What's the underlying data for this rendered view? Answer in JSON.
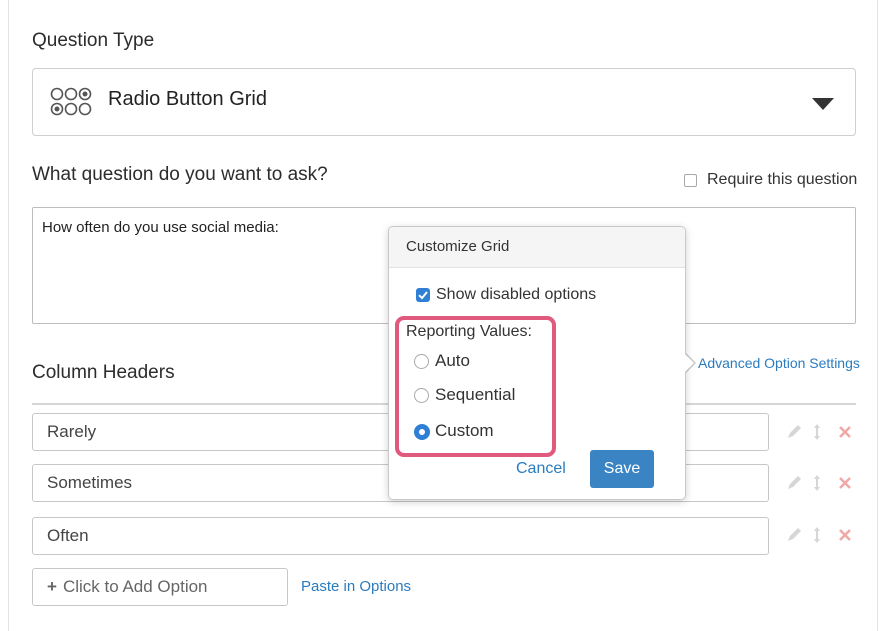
{
  "question_type": {
    "label": "Question Type",
    "selected": "Radio Button Grid"
  },
  "question": {
    "label": "What question do you want to ask?",
    "require_label": "Require this question",
    "require_checked": false,
    "text": "How often do you use social media:"
  },
  "columns": {
    "label": "Column Headers",
    "advanced_link": "Advanced Option Settings",
    "options": [
      "Rarely",
      "Sometimes",
      "Often"
    ],
    "add_placeholder": "Click to Add Option",
    "paste_link": "Paste in Options"
  },
  "popover": {
    "title": "Customize Grid",
    "show_disabled_label": "Show disabled options",
    "show_disabled_checked": true,
    "reporting_label": "Reporting Values:",
    "radios": [
      {
        "label": "Auto",
        "checked": false
      },
      {
        "label": "Sequential",
        "checked": false
      },
      {
        "label": "Custom",
        "checked": true
      }
    ],
    "cancel_label": "Cancel",
    "save_label": "Save"
  },
  "colors": {
    "accent": "#2f7fd6",
    "link": "#2b7bbf",
    "highlight": "#e05a7e",
    "save_button": "#3a84c4"
  }
}
